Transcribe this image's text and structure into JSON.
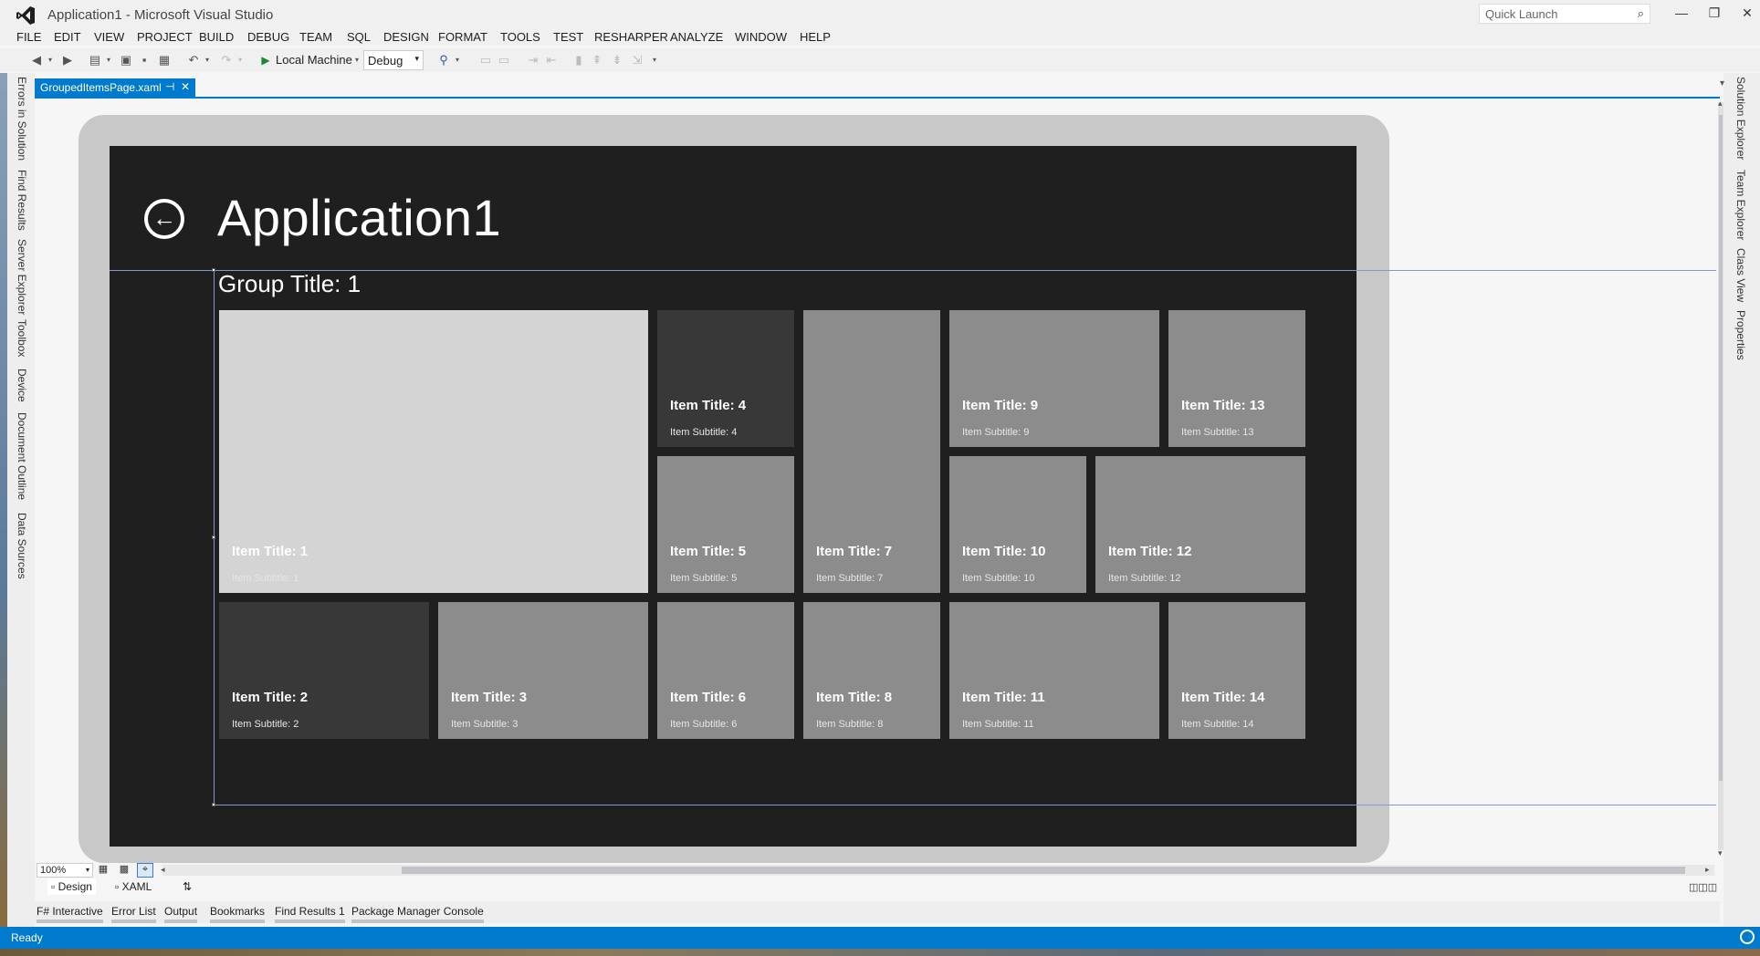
{
  "window": {
    "title": "Application1 - Microsoft Visual Studio",
    "quick_launch_placeholder": "Quick Launch",
    "minimize": "—",
    "restore": "❐",
    "close": "✕"
  },
  "menu": [
    "FILE",
    "EDIT",
    "VIEW",
    "PROJECT",
    "BUILD",
    "DEBUG",
    "TEAM",
    "SQL",
    "DESIGN",
    "FORMAT",
    "TOOLS",
    "TEST",
    "RESHARPER",
    "ANALYZE",
    "WINDOW",
    "HELP"
  ],
  "toolbar": {
    "run_target": "Local Machine",
    "configuration": "Debug"
  },
  "left_tabs": [
    "Errors in Solution",
    "Find Results",
    "Server Explorer",
    "Toolbox",
    "Device",
    "Document Outline",
    "Data Sources"
  ],
  "right_tabs": [
    "Solution Explorer",
    "Team Explorer",
    "Class View",
    "Properties"
  ],
  "document_tab": {
    "label": "GroupedItemsPage.xaml",
    "pin": "⊣",
    "close": "✕"
  },
  "app": {
    "back_glyph": "←",
    "page_title": "Application1",
    "group_title": "Group Title: 1",
    "tiles": [
      {
        "title": "Item Title: 1",
        "subtitle": "Item Subtitle: 1",
        "shade": "#d4d4d4"
      },
      {
        "title": "Item Title: 2",
        "subtitle": "Item Subtitle: 2",
        "shade": "#383838"
      },
      {
        "title": "Item Title: 3",
        "subtitle": "Item Subtitle: 3",
        "shade": "#8c8c8c"
      },
      {
        "title": "Item Title: 4",
        "subtitle": "Item Subtitle: 4",
        "shade": "#383838"
      },
      {
        "title": "Item Title: 5",
        "subtitle": "Item Subtitle: 5",
        "shade": "#8c8c8c"
      },
      {
        "title": "Item Title: 6",
        "subtitle": "Item Subtitle: 6",
        "shade": "#8c8c8c"
      },
      {
        "title": "Item Title: 7",
        "subtitle": "Item Subtitle: 7",
        "shade": "#8c8c8c"
      },
      {
        "title": "Item Title: 8",
        "subtitle": "Item Subtitle: 8",
        "shade": "#8c8c8c"
      },
      {
        "title": "Item Title: 9",
        "subtitle": "Item Subtitle: 9",
        "shade": "#8c8c8c"
      },
      {
        "title": "Item Title: 10",
        "subtitle": "Item Subtitle: 10",
        "shade": "#8c8c8c"
      },
      {
        "title": "Item Title: 11",
        "subtitle": "Item Subtitle: 11",
        "shade": "#8c8c8c"
      },
      {
        "title": "Item Title: 12",
        "subtitle": "Item Subtitle: 12",
        "shade": "#8c8c8c"
      },
      {
        "title": "Item Title: 13",
        "subtitle": "Item Subtitle: 13",
        "shade": "#8c8c8c"
      },
      {
        "title": "Item Title: 14",
        "subtitle": "Item Subtitle: 14",
        "shade": "#8c8c8c"
      }
    ]
  },
  "designer": {
    "zoom": "100%",
    "design_tab": "Design",
    "xaml_tab": "XAML"
  },
  "bottom_tabs": [
    "F# Interactive",
    "Error List",
    "Output",
    "Bookmarks",
    "Find Results 1",
    "Package Manager Console"
  ],
  "status": {
    "text": "Ready",
    "bar_color": "#007acc"
  }
}
